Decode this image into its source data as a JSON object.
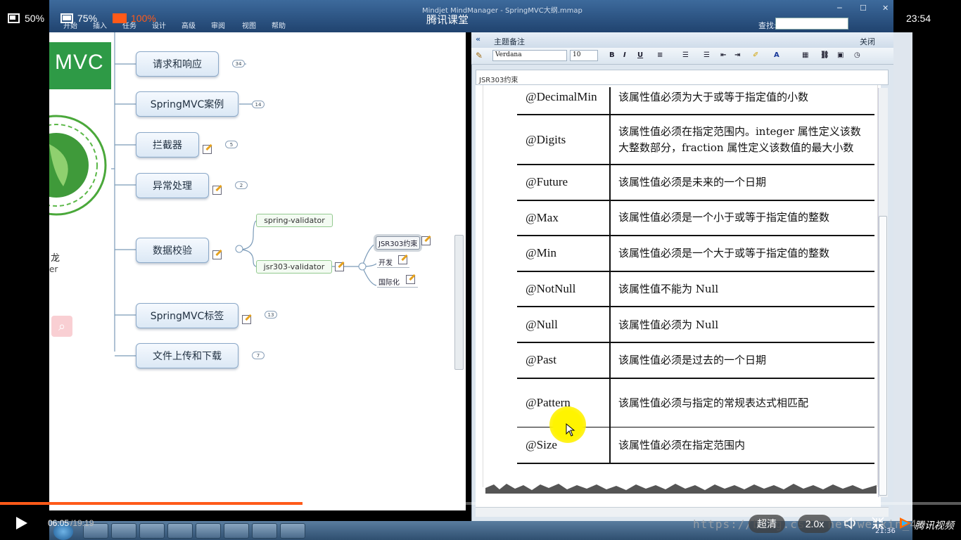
{
  "player": {
    "views": [
      {
        "label": "50%",
        "icon": "view-small-icon"
      },
      {
        "label": "75%",
        "icon": "view-medium-icon"
      },
      {
        "label": "100%",
        "icon": "view-full-icon",
        "active": true
      }
    ],
    "title": "腾讯课堂",
    "clock": "23:54",
    "time_current": "06:05",
    "time_total": "/19:19",
    "progress": 0.315,
    "quality": "超清",
    "speed": "2.0x",
    "brand": "腾讯视频",
    "watermark": "https://blog.csdn.net/weixin_4...",
    "accent": "#ff5a19"
  },
  "app": {
    "window_title": "Mindjet MindManager - SpringMVC大纲.mmap",
    "tabs": [
      "开始",
      "插入",
      "任务",
      "设计",
      "高级",
      "审阅",
      "视图",
      "帮助"
    ],
    "search_label": "查找:",
    "logo_text": "MVC",
    "side_name": "龙",
    "side_role": "er"
  },
  "mindmap": {
    "topics": [
      {
        "label": "请求和响应",
        "badge": "34"
      },
      {
        "label": "SpringMVC案例",
        "badge": "14"
      },
      {
        "label": "拦截器",
        "badge": "5"
      },
      {
        "label": "异常处理",
        "badge": "2"
      },
      {
        "label": "数据校验",
        "badge": ""
      },
      {
        "label": "SpringMVC标签",
        "badge": "13"
      },
      {
        "label": "文件上传和下载",
        "badge": "7"
      }
    ],
    "subtopics": [
      "spring-validator",
      "jsr303-validator"
    ],
    "leaves": [
      "JSR303约束",
      "开发",
      "国际化"
    ]
  },
  "notes": {
    "header_title": "主题备注",
    "close_label": "关闭",
    "font_name": "Verdana",
    "font_size": "10",
    "doc_tab": "JSR303约束",
    "rows": [
      {
        "annotation": "@DecimalMin",
        "desc": "该属性值必须为大于或等于指定值的小数"
      },
      {
        "annotation": "@Digits",
        "desc": "该属性值必须在指定范围内。integer 属性定义该数",
        "desc2": "大整数部分，fraction 属性定义该数值的最大小数"
      },
      {
        "annotation": "@Future",
        "desc": "该属性值必须是未来的一个日期"
      },
      {
        "annotation": "@Max",
        "desc": "该属性值必须是一个小于或等于指定值的整数"
      },
      {
        "annotation": "@Min",
        "desc": "该属性值必须是一个大于或等于指定值的整数"
      },
      {
        "annotation": "@NotNull",
        "desc": "该属性值不能为 Null"
      },
      {
        "annotation": "@Null",
        "desc": "该属性值必须为 Null"
      },
      {
        "annotation": "@Past",
        "desc": "该属性值必须是过去的一个日期"
      },
      {
        "annotation": "@Pattern",
        "desc": "该属性值必须与指定的常规表达式相匹配"
      },
      {
        "annotation": "@Size",
        "desc": "该属性值必须在指定范围内"
      }
    ]
  },
  "taskbar": {
    "clock": "21:36"
  }
}
